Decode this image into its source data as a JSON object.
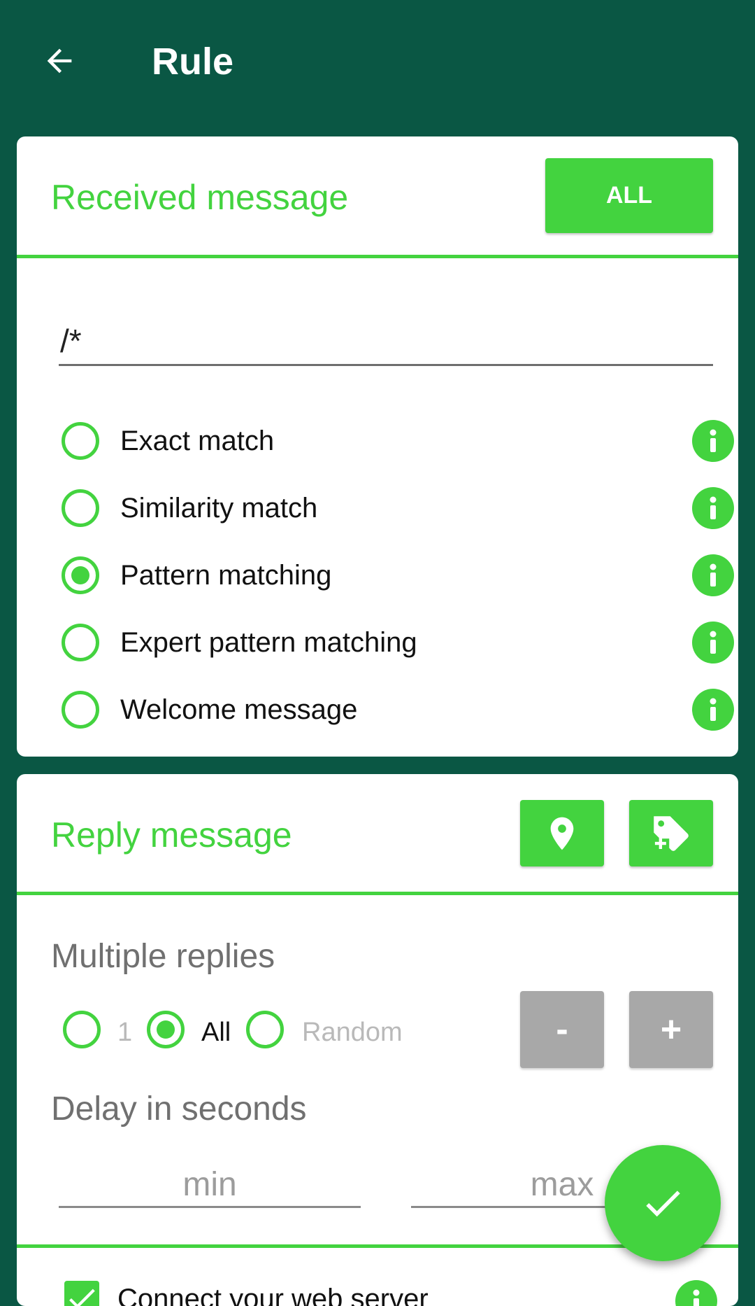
{
  "appbar": {
    "title": "Rule"
  },
  "received": {
    "title": "Received message",
    "all_button": "ALL",
    "pattern_value": "/*",
    "options": [
      {
        "label": "Exact match",
        "checked": false
      },
      {
        "label": "Similarity match",
        "checked": false
      },
      {
        "label": "Pattern matching",
        "checked": true
      },
      {
        "label": "Expert pattern matching",
        "checked": false
      },
      {
        "label": "Welcome message",
        "checked": false
      }
    ]
  },
  "reply": {
    "title": "Reply message",
    "multiple_label": "Multiple replies",
    "multiple_options": [
      {
        "label": "1",
        "checked": false
      },
      {
        "label": "All",
        "checked": true
      },
      {
        "label": "Random",
        "checked": false
      }
    ],
    "minus_label": "-",
    "plus_label": "+",
    "delay_label": "Delay in seconds",
    "min_placeholder": "min",
    "max_placeholder": "max",
    "webserver_label": "Connect your web server",
    "webserver_checked": true
  },
  "colors": {
    "primary_dark": "#0a5744",
    "accent": "#43d33f",
    "disabled": "#a8a8a8"
  },
  "icons": [
    "arrow-left-icon",
    "info-icon",
    "map-marker-icon",
    "tag-plus-icon",
    "check-icon"
  ]
}
